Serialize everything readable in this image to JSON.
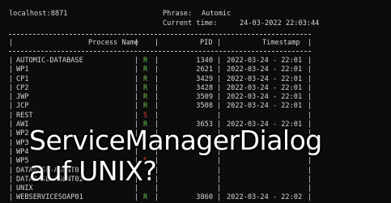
{
  "header": {
    "host": "localhost:8871",
    "phrase_label": "Phrase:",
    "phrase_value": "Automic",
    "time_label": "Current time:",
    "time_value": "24-03-2022 22:03:44"
  },
  "table": {
    "columns": [
      "Process Name",
      "PID",
      "Timestamp"
    ],
    "rows": [
      {
        "name": "AUTOMIC-DATABASE",
        "state": "R",
        "pid": "1340",
        "timestamp": "2022-03-24 - 22:01"
      },
      {
        "name": "WP1",
        "state": "R",
        "pid": "2621",
        "timestamp": "2022-03-24 - 22:01"
      },
      {
        "name": "CP1",
        "state": "R",
        "pid": "3429",
        "timestamp": "2022-03-24 - 22:01"
      },
      {
        "name": "CP2",
        "state": "R",
        "pid": "3428",
        "timestamp": "2022-03-24 - 22:01"
      },
      {
        "name": "JWP",
        "state": "R",
        "pid": "3509",
        "timestamp": "2022-03-24 - 22:01"
      },
      {
        "name": "JCP",
        "state": "R",
        "pid": "3508",
        "timestamp": "2022-03-24 - 22:01"
      },
      {
        "name": "REST",
        "state": "S",
        "pid": "",
        "timestamp": ""
      },
      {
        "name": "AWI",
        "state": "R",
        "pid": "3653",
        "timestamp": "2022-03-24 - 22:01"
      },
      {
        "name": "WP2",
        "state": "",
        "pid": "",
        "timestamp": ""
      },
      {
        "name": "WP3",
        "state": "",
        "pid": "",
        "timestamp": ""
      },
      {
        "name": "WP4",
        "state": "",
        "pid": "",
        "timestamp": ""
      },
      {
        "name": "WP5",
        "state": "S",
        "pid": "",
        "timestamp": ""
      },
      {
        "name": "DATABASE-AGENT01",
        "state": "",
        "pid": "",
        "timestamp": ""
      },
      {
        "name": "DATABASE-AGENT02",
        "state": "",
        "pid": "",
        "timestamp": ""
      },
      {
        "name": "UNIX",
        "state": "",
        "pid": "",
        "timestamp": ""
      },
      {
        "name": "WEBSERVICESOAP01",
        "state": "R",
        "pid": "3860",
        "timestamp": "2022-03-24 - 22:02"
      }
    ]
  },
  "overlay": {
    "line1": "ServiceManagerDialog",
    "line2": "auf UNIX?"
  },
  "colors": {
    "background": "#0c0c0c",
    "running": "#6cc24a",
    "stopped": "#e04040",
    "text": "#d6d6d6"
  }
}
